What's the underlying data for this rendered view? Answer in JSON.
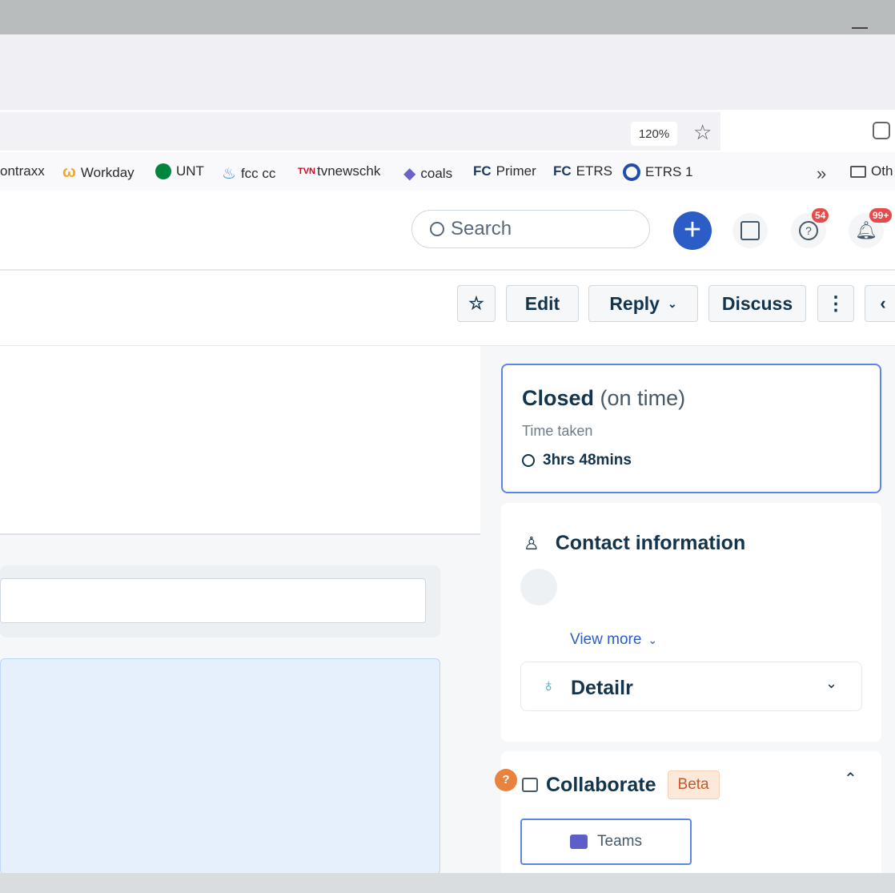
{
  "browser": {
    "zoom_level": "120%",
    "bookmarks": [
      {
        "label": "ontraxx",
        "icon": "none"
      },
      {
        "label": "Workday",
        "icon": "workday-icon",
        "color": "#f5a623"
      },
      {
        "label": "UNT",
        "icon": "unt-icon",
        "color": "#00853e"
      },
      {
        "label": "fcc cc",
        "icon": "fcc-icon",
        "color": "#4a90d9"
      },
      {
        "label": "tvnewschk",
        "icon": "tvn-icon",
        "color": "#d0021b"
      },
      {
        "label": "coals",
        "icon": "diamond-icon",
        "color": "#6b63c9"
      },
      {
        "label": "Primer",
        "icon": "fc-icon",
        "color": "#1f3b63"
      },
      {
        "label": "ETRS",
        "icon": "fc-icon",
        "color": "#1f3b63"
      },
      {
        "label": "ETRS 1",
        "icon": "circle-icon",
        "color": "#1f4fa8"
      }
    ],
    "overflow_label": "Oth",
    "bm_prefix_fc": "FC",
    "bm_prefix_tvn": "TVN"
  },
  "header": {
    "search_placeholder": "Search",
    "help_badge": "54",
    "notif_badge": "99+"
  },
  "toolbar": {
    "edit": "Edit",
    "reply": "Reply",
    "discuss": "Discuss"
  },
  "status_card": {
    "status": "Closed",
    "qualifier": "(on time)",
    "time_label": "Time taken",
    "time_value": "3hrs 48mins"
  },
  "contact_card": {
    "title": "Contact information",
    "view_more": "View more",
    "detail": "Detailr"
  },
  "collab_card": {
    "title": "Collaborate",
    "badge": "Beta",
    "teams_label": "Teams"
  },
  "colors": {
    "accent": "#2c5cc5",
    "status_border": "#5b85e8",
    "beta_bg": "#fde9d9",
    "beta_text": "#c8572c"
  }
}
